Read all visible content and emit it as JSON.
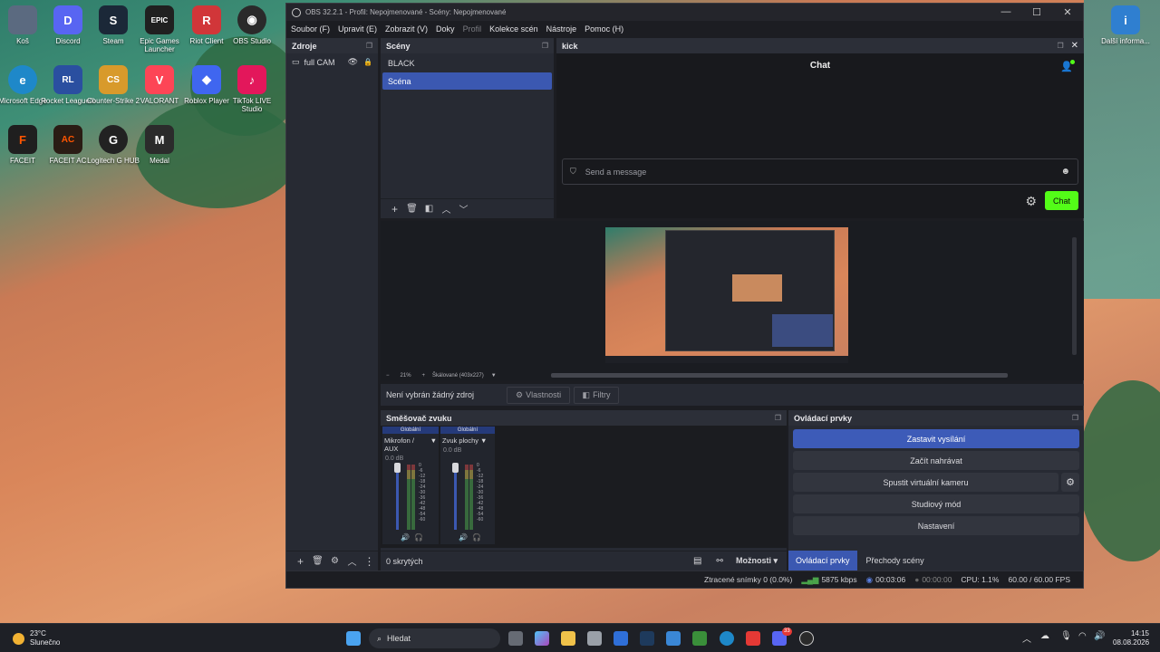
{
  "desktop": {
    "icons": [
      {
        "label": "Koš",
        "color": "#5b6a80",
        "glyph": "♻"
      },
      {
        "label": "Discord",
        "color": "#5865f2",
        "glyph": "D"
      },
      {
        "label": "Steam",
        "color": "#1b2838",
        "glyph": "S"
      },
      {
        "label": "Epic Games Launcher",
        "color": "#202020",
        "glyph": "EPIC"
      },
      {
        "label": "Riot Client",
        "color": "#d13639",
        "glyph": "R"
      },
      {
        "label": "OBS Studio",
        "color": "#2a2a2a",
        "glyph": "◉"
      },
      {
        "label": "Microsoft Edge",
        "color": "#1e88c9",
        "glyph": "e"
      },
      {
        "label": "Rocket League®",
        "color": "#2a4fa0",
        "glyph": "RL"
      },
      {
        "label": "Counter-Strike 2",
        "color": "#d89a2b",
        "glyph": "CS"
      },
      {
        "label": "VALORANT",
        "color": "#fd4556",
        "glyph": "V"
      },
      {
        "label": "Roblox Player",
        "color": "#3f66f0",
        "glyph": "◆"
      },
      {
        "label": "TikTok LIVE Studio",
        "color": "#e3175b",
        "glyph": "♪"
      },
      {
        "label": "FACEIT",
        "color": "#1f1f1f",
        "glyph": "F"
      },
      {
        "label": "FACEIT AC",
        "color": "#2a1c14",
        "glyph": "AC"
      },
      {
        "label": "Logitech G HUB",
        "color": "#222",
        "glyph": "G"
      },
      {
        "label": "Medal",
        "color": "#2b2b2b",
        "glyph": "M"
      },
      {
        "label": "Další informa...",
        "color": "#2f7fd0",
        "glyph": "i"
      }
    ]
  },
  "window": {
    "title": "OBS 32.2.1 - Profil: Nepojmenované - Scény: Nepojmenované",
    "controls": [
      "—",
      "☐",
      "✕"
    ],
    "menu": [
      "Soubor (F)",
      "Upravit (E)",
      "Zobrazit (V)",
      "Doky",
      "Profil",
      "Kolekce scén",
      "Nástroje",
      "Pomoc (H)"
    ]
  },
  "sources": {
    "title": "Zdroje",
    "items": [
      {
        "label": "full CAM"
      }
    ]
  },
  "scenes": {
    "title": "Scény",
    "items": [
      {
        "label": "BLACK"
      },
      {
        "label": "Scéna"
      }
    ]
  },
  "kick": {
    "title": "kick",
    "chat_title": "Chat",
    "message_placeholder": "Send a message",
    "chat_button": "Chat"
  },
  "preview": {
    "zoom_minus": "−",
    "zoom_value": "21%",
    "zoom_plus": "+",
    "scale_label": "Škálované (403x227)"
  },
  "source_bar": {
    "no_source": "Není vybrán žádný zdroj",
    "properties": "Vlastnosti",
    "filters": "Filtry"
  },
  "mixer": {
    "title": "Směšovač zvuku",
    "channels": [
      {
        "badge": "Globální",
        "name": "Mikrofon / AUX",
        "db": "0.0 dB",
        "level": 0.0
      },
      {
        "badge": "Globální",
        "name": "Zvuk plochy",
        "db": "0.0 dB",
        "level": 0.0
      }
    ],
    "ticks": [
      "0",
      "-6",
      "-12",
      "-18",
      "-24",
      "-30",
      "-36",
      "-42",
      "-48",
      "-54",
      "-60"
    ],
    "hidden": "0 skrytých",
    "options": "Možnosti"
  },
  "controls": {
    "title": "Ovládací prvky",
    "buttons": {
      "stop_stream": "Zastavit vysílání",
      "start_record": "Začít nahrávat",
      "virtual_cam": "Spustit virtuální kameru",
      "studio_mode": "Studiový mód",
      "settings": "Nastavení"
    },
    "tabs": [
      "Ovládací prvky",
      "Přechody scény"
    ]
  },
  "status": {
    "dropped": "Ztracené snímky 0 (0.0%)",
    "bitrate": "5875 kbps",
    "stream_time": "00:03:06",
    "rec_time": "00:00:00",
    "cpu": "CPU: 1.1%",
    "fps": "60.00 / 60.00 FPS"
  },
  "taskbar": {
    "weather_temp": "23°C",
    "weather_desc": "Slunečno",
    "search": "Hledat",
    "time": "14:15",
    "date": "08.08.2026",
    "chat_badge": "33"
  }
}
